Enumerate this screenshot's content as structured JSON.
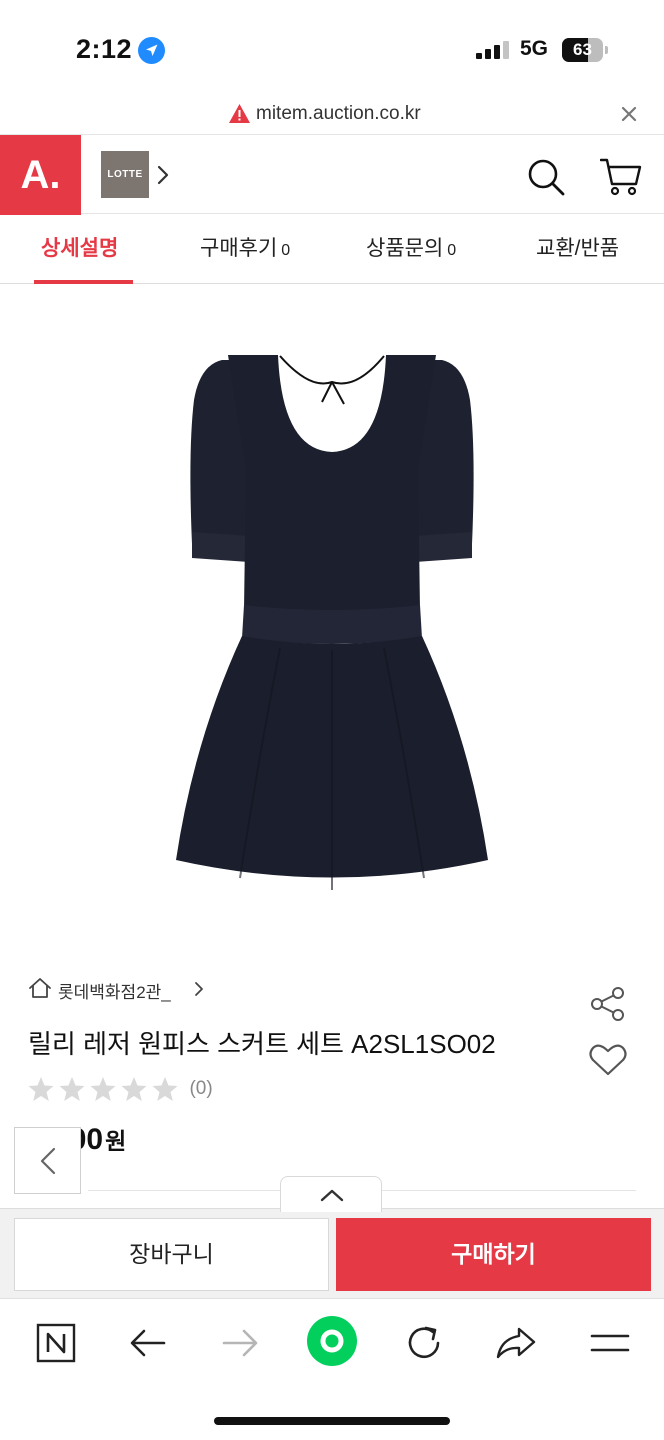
{
  "status_bar": {
    "time": "2:12",
    "network": "5G",
    "battery": "63",
    "battery_level": 0.63
  },
  "url_bar": {
    "url": "mitem.auction.co.kr"
  },
  "header": {
    "logo": "A.",
    "brand": "LOTTE"
  },
  "tabs": [
    {
      "label": "상세설명",
      "count": ""
    },
    {
      "label": "구매후기",
      "count": "0"
    },
    {
      "label": "상품문의",
      "count": "0"
    },
    {
      "label": "교환/반품",
      "count": ""
    }
  ],
  "product": {
    "store": "롯데백화점2관_",
    "title": "릴리 레저 원피스 스커트 세트 A2SL1SO02",
    "stars": 0,
    "review_count": "(0)",
    "price": "3,000",
    "currency": "원"
  },
  "actions": {
    "cart_label": "장바구니",
    "buy_label": "구매하기"
  },
  "colors": {
    "brand_red": "#e63946",
    "rating_star": "#d9d9d9",
    "browser_green": "#03cf5d"
  },
  "icons": [
    "location-arrow-icon",
    "signal-icon",
    "warning-icon",
    "close-icon",
    "chevron-right-icon",
    "search-icon",
    "cart-icon",
    "home-icon",
    "share-icon",
    "heart-icon",
    "star-icon",
    "chevron-left-icon",
    "chevron-up-icon",
    "naver-n-icon",
    "back-arrow-icon",
    "forward-arrow-icon",
    "green-dot-icon",
    "refresh-icon",
    "share-arrow-icon",
    "menu-icon"
  ]
}
